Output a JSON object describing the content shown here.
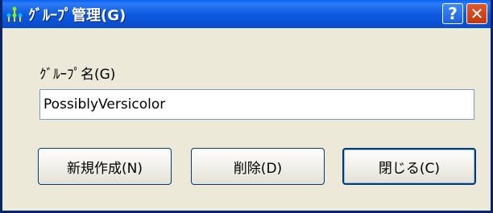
{
  "window": {
    "title": "ｸﾞﾙｰﾌﾟ管理(G)",
    "help_glyph": "?",
    "close_glyph": "✕",
    "icon": "group-network-icon"
  },
  "form": {
    "group_name_label": "ｸﾞﾙｰﾌﾟ名(G)",
    "group_name_value": "PossiblyVersicolor"
  },
  "buttons": {
    "new_label": "新規作成(N)",
    "delete_label": "削除(D)",
    "close_label": "閉じる(C)"
  },
  "colors": {
    "titlebar": "#0A4CC7",
    "dialog_bg": "#ECE9D8",
    "close_button": "#C1380E"
  }
}
